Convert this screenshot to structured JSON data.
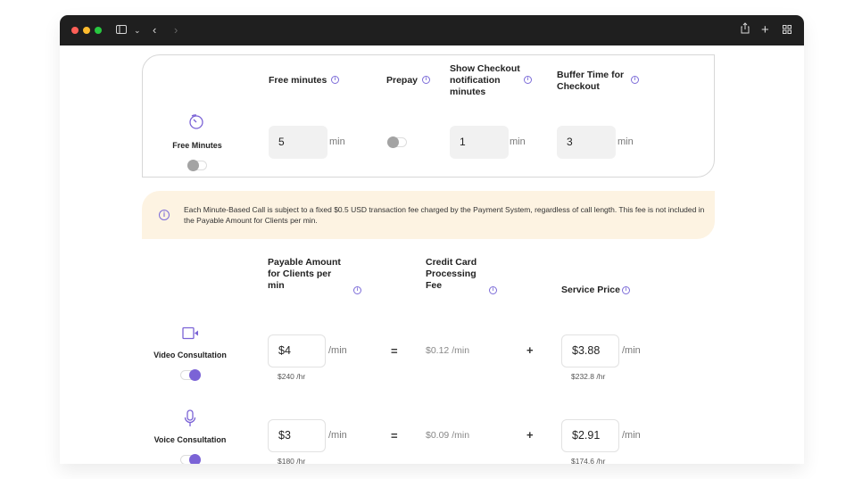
{
  "colors": {
    "accent": "#7b63d6",
    "notice_bg": "#fdf3e2",
    "titlebar": "#1f1f1f"
  },
  "browser": {
    "icons": [
      "sidebar-icon",
      "chevron-down-icon",
      "back-icon",
      "forward-icon",
      "share-icon",
      "plus-icon",
      "tabs-grid-icon"
    ]
  },
  "free_minutes": {
    "label": "Free Minutes",
    "toggle_on": false,
    "headers": {
      "free_minutes": "Free minutes",
      "prepay": "Prepay",
      "show_checkout": "Show Checkout notification minutes",
      "buffer_time": "Buffer Time for Checkout"
    },
    "free_minutes_value": "5",
    "notification_value": "1",
    "buffer_value": "3",
    "unit": "min",
    "prepay_on": false
  },
  "notice": {
    "text": "Each Minute-Based Call is subject to a fixed $0.5 USD transaction fee charged by the Payment System, regardless of call length. This fee is not included in the Payable Amount for Clients per min."
  },
  "pricing": {
    "headers": {
      "payable": "Payable Amount for Clients per min",
      "processing": "Credit Card Processing Fee",
      "service": "Service Price"
    },
    "equals": "=",
    "plus": "+",
    "per_min": "/min",
    "rows": [
      {
        "label": "Video Consultation",
        "toggle_on": true,
        "payable": "$4",
        "payable_hr": "$240 /hr",
        "fee": "$0.12 /min",
        "service": "$3.88",
        "service_hr": "$232.8 /hr"
      },
      {
        "label": "Voice Consultation",
        "toggle_on": true,
        "payable": "$3",
        "payable_hr": "$180 /hr",
        "fee": "$0.09 /min",
        "service": "$2.91",
        "service_hr": "$174.6 /hr"
      }
    ]
  }
}
